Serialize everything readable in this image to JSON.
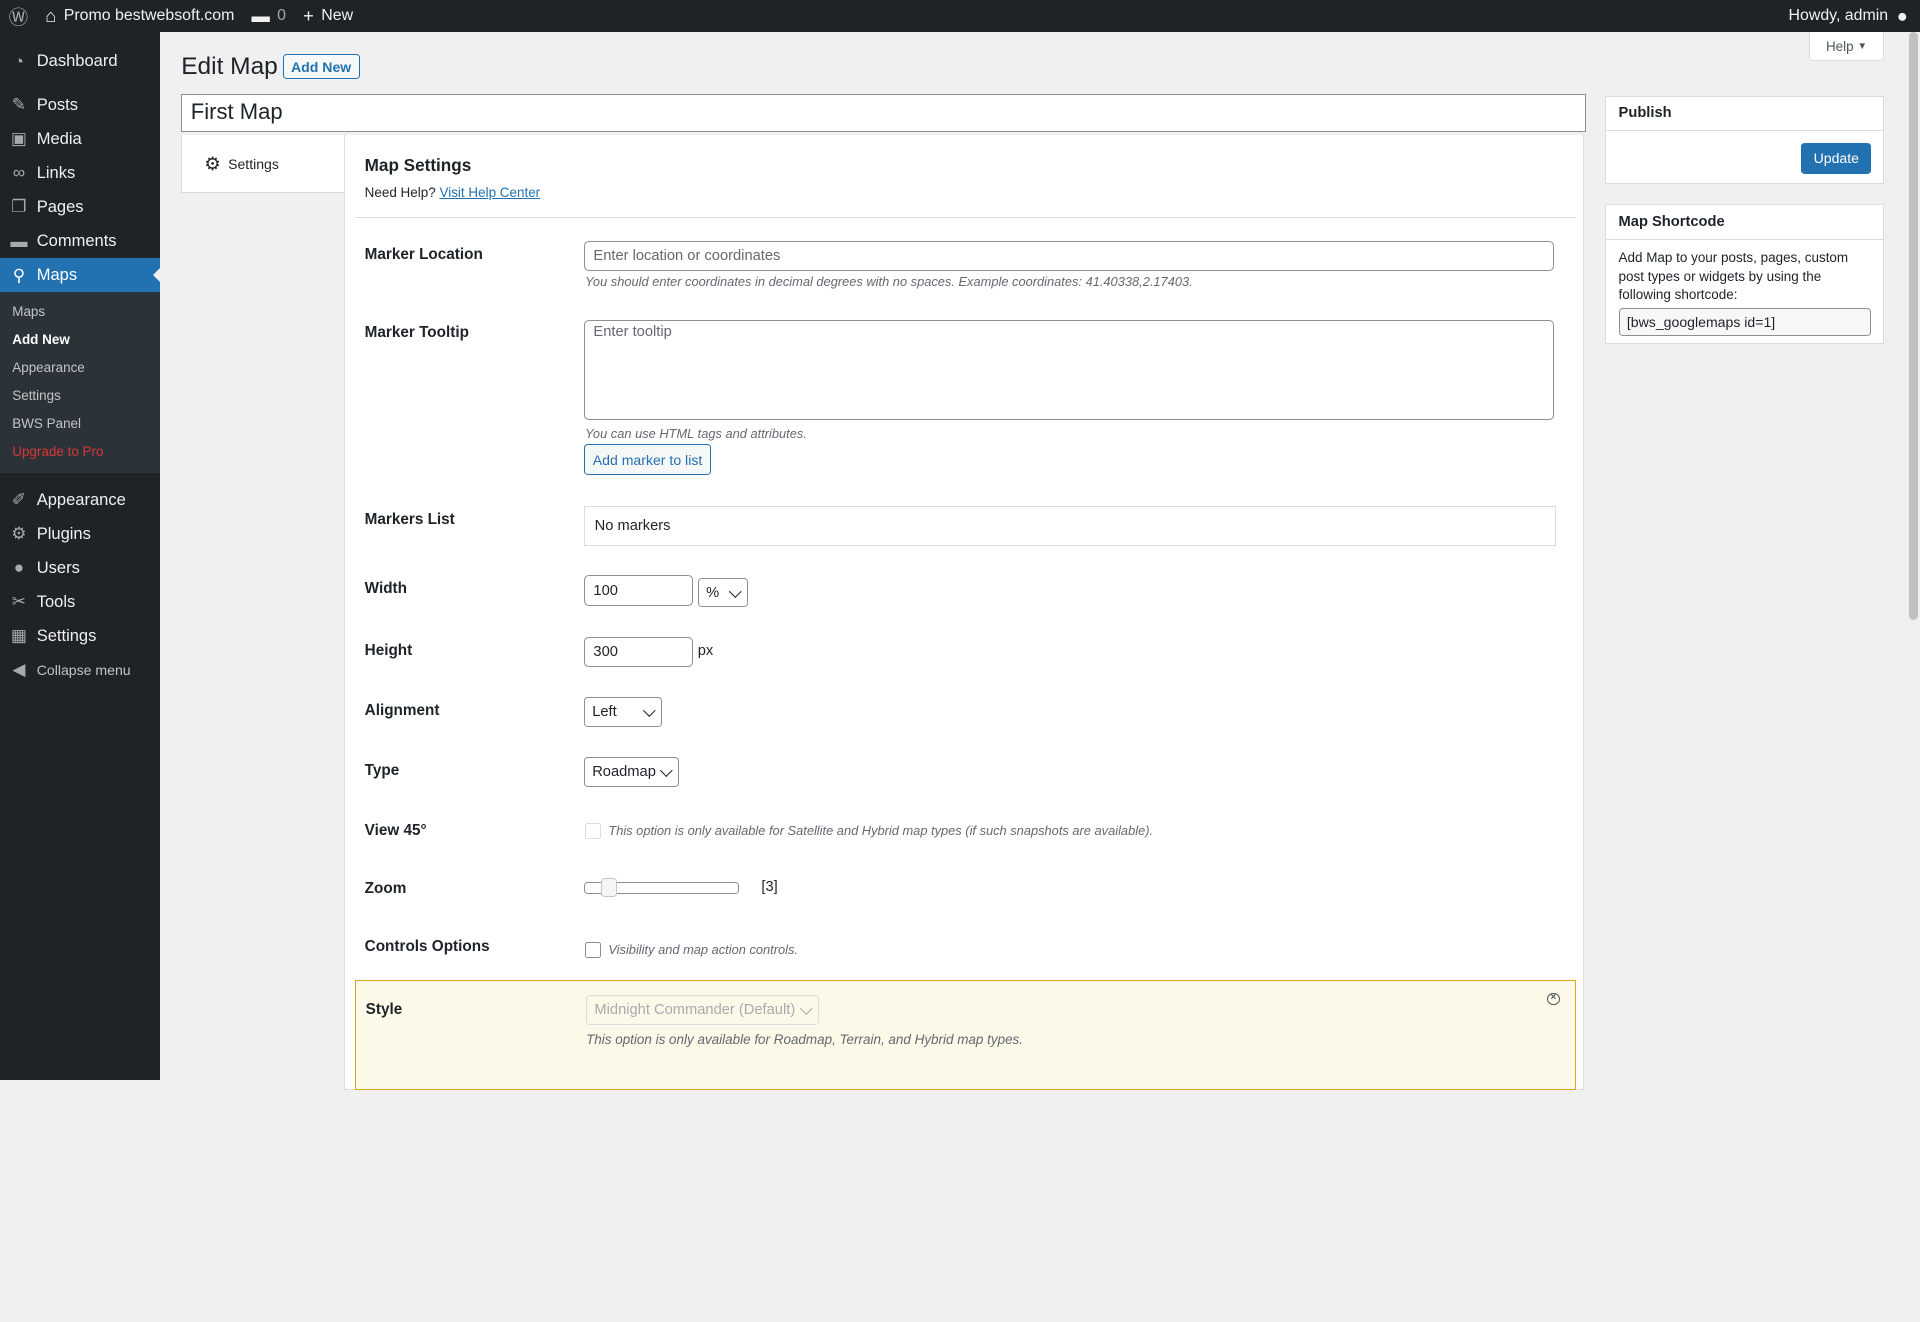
{
  "admin_bar": {
    "site_name": "Promo bestwebsoft.com",
    "comments_count": "0",
    "new_label": "New",
    "howdy": "Howdy, admin"
  },
  "sidebar": {
    "items": [
      {
        "label": "Dashboard",
        "icon": "dashboard-icon"
      },
      {
        "label": "Posts",
        "icon": "pin-icon"
      },
      {
        "label": "Media",
        "icon": "media-icon"
      },
      {
        "label": "Links",
        "icon": "link-icon"
      },
      {
        "label": "Pages",
        "icon": "pages-icon"
      },
      {
        "label": "Comments",
        "icon": "comment-icon"
      },
      {
        "label": "Maps",
        "icon": "location-icon"
      }
    ],
    "submenu": [
      "Maps",
      "Add New",
      "Appearance",
      "Settings",
      "BWS Panel",
      "Upgrade to Pro"
    ],
    "items2": [
      {
        "label": "Appearance",
        "icon": "brush-icon"
      },
      {
        "label": "Plugins",
        "icon": "plugin-icon"
      },
      {
        "label": "Users",
        "icon": "user-icon"
      },
      {
        "label": "Tools",
        "icon": "wrench-icon"
      },
      {
        "label": "Settings",
        "icon": "settings-icon"
      }
    ],
    "collapse": "Collapse menu"
  },
  "header": {
    "help": "Help",
    "title": "Edit Map",
    "add_new": "Add New",
    "map_title": "First Map"
  },
  "tabs": {
    "settings": "Settings"
  },
  "map_settings": {
    "heading": "Map Settings",
    "need_help": "Need Help?",
    "help_link": "Visit Help Center",
    "marker_location_label": "Marker Location",
    "marker_location_placeholder": "Enter location or coordinates",
    "marker_location_desc": "You should enter coordinates in decimal degrees with no spaces. Example coordinates: 41.40338,2.17403.",
    "marker_tooltip_label": "Marker Tooltip",
    "marker_tooltip_placeholder": "Enter tooltip",
    "marker_tooltip_desc": "You can use HTML tags and attributes.",
    "add_marker_button": "Add marker to list",
    "markers_list_label": "Markers List",
    "markers_list_value": "No markers",
    "width_label": "Width",
    "width_value": "100",
    "width_unit": "%",
    "height_label": "Height",
    "height_value": "300",
    "height_unit": "px",
    "alignment_label": "Alignment",
    "alignment_value": "Left",
    "type_label": "Type",
    "type_value": "Roadmap",
    "view45_label": "View 45°",
    "view45_desc": "This option is only available for Satellite and Hybrid map types (if such snapshots are available).",
    "zoom_label": "Zoom",
    "zoom_value": "[3]",
    "controls_label": "Controls Options",
    "controls_desc": "Visibility and map action controls.",
    "style_label": "Style",
    "style_value": "Midnight Commander (Default)",
    "style_desc": "This option is only available for Roadmap, Terrain, and Hybrid map types."
  },
  "publish": {
    "title": "Publish",
    "update": "Update"
  },
  "shortcode": {
    "title": "Map Shortcode",
    "text": "Add Map to your posts, pages, custom post types or widgets by using the following shortcode:",
    "code": "[bws_googlemaps id=1]"
  },
  "colors": {
    "accent": "#2271b1",
    "sidebar_bg": "#1d2327",
    "notice_bg": "#fcf9e8"
  }
}
